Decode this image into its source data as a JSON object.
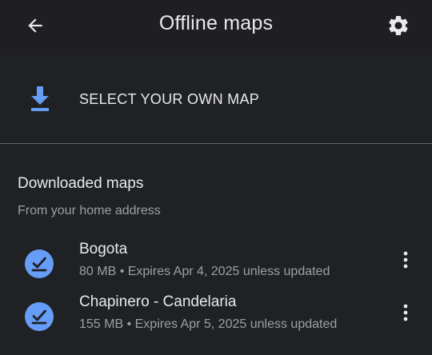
{
  "appbar": {
    "title": "Offline maps",
    "back_icon": "arrow-back-icon",
    "settings_icon": "gear-icon"
  },
  "select_own_map": {
    "label": "SELECT YOUR OWN MAP",
    "icon": "download-icon"
  },
  "downloaded": {
    "title": "Downloaded maps",
    "subtitle": "From your home address",
    "items": [
      {
        "name": "Bogota",
        "meta": "80 MB • Expires Apr 4, 2025 unless updated"
      },
      {
        "name": "Chapinero - Candelaria",
        "meta": "155 MB • Expires Apr 5, 2025 unless updated"
      }
    ]
  },
  "colors": {
    "background": "#202124",
    "accent_blue": "#669df6",
    "text_primary": "#e8eaed",
    "text_secondary": "#9aa0a6"
  }
}
